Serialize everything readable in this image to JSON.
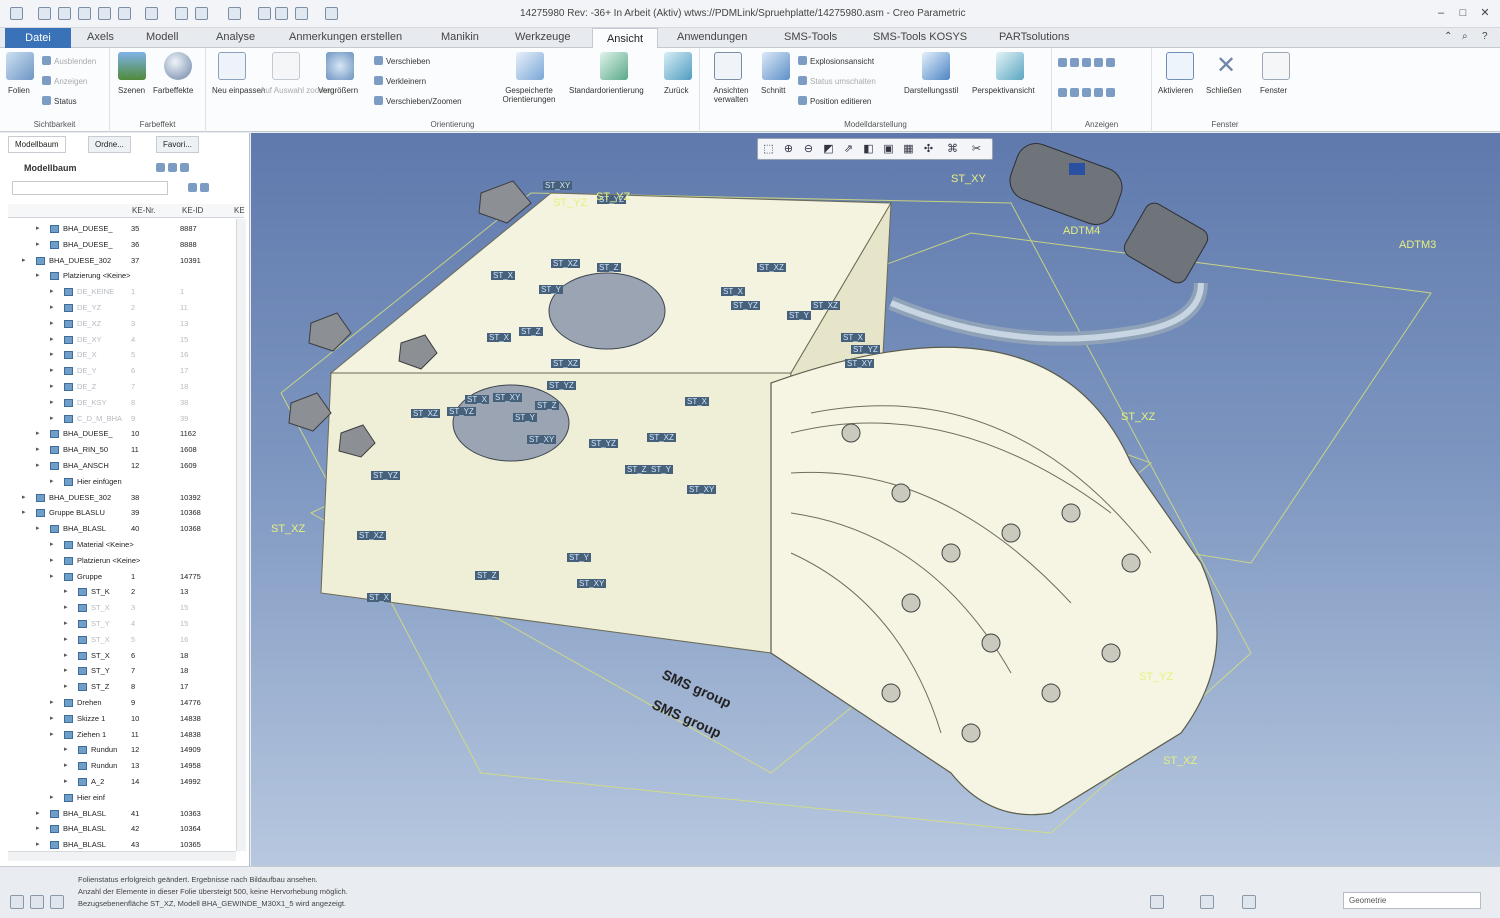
{
  "app": {
    "title": "14275980 Rev: -36+ In Arbeit (Aktiv) wtws://PDMLink/Spruehplatte/14275980.asm - Creo Parametric",
    "window_controls": [
      "minimize-icon",
      "restore-icon",
      "close-icon"
    ]
  },
  "menu": {
    "file": "Datei",
    "tabs": [
      "Axels",
      "Modell",
      "Analyse",
      "Anmerkungen erstellen",
      "Manikin",
      "Werkzeuge",
      "Ansicht",
      "Anwendungen",
      "SMS-Tools",
      "SMS-Tools KOSYS",
      "PARTsolutions"
    ],
    "active": "Ansicht"
  },
  "ribbon": {
    "sichtbarkeit": {
      "label": "Sichtbarkeit",
      "folien": "Folien",
      "ausblenden": "Ausblenden",
      "anzeigen": "Anzeigen",
      "status": "Status"
    },
    "farbeffekt": {
      "label": "Farbeffekt",
      "szenen": "Szenen",
      "farbeffekte": "Farbeffekte"
    },
    "orientierung": {
      "label": "Orientierung",
      "neu_einpassen": "Neu einpassen",
      "auf_auswahl_zoomen": "Auf Auswahl zoomen",
      "vergroessern": "Vergrößern",
      "verschieben": "Verschieben",
      "verkleinern": "Verkleinern",
      "verschieben_zoomen": "Verschieben/Zoomen",
      "gespeicherte": "Gespeicherte Orientierungen",
      "standard": "Standardorientierung",
      "zurueck": "Zurück"
    },
    "modelldarstellung": {
      "label": "Modelldarstellung",
      "ansichten_verwalten": "Ansichten verwalten",
      "schnitt": "Schnitt",
      "explosion": "Explosionsansicht",
      "status_umschalten": "Status umschalten",
      "position_editieren": "Position editieren",
      "darstellungsstil": "Darstellungsstil",
      "perspektive": "Perspektivansicht"
    },
    "anzeigen": {
      "label": "Anzeigen"
    },
    "fenster": {
      "label": "Fenster",
      "aktivieren": "Aktivieren",
      "schliessen": "Schließen",
      "fenster": "Fenster"
    }
  },
  "sidebar": {
    "tabs": [
      "Modellbaum",
      "Ordne...",
      "Favori..."
    ],
    "title": "Modellbaum",
    "columns": [
      "KE-Nr.",
      "KE-ID",
      "KE"
    ],
    "rows": [
      {
        "name": "BHA_DUESE_",
        "ke": "35",
        "id": "8887",
        "indent": 1,
        "dim": false
      },
      {
        "name": "BHA_DUESE_",
        "ke": "36",
        "id": "8888",
        "indent": 1,
        "dim": false
      },
      {
        "name": "BHA_DUESE_302",
        "ke": "37",
        "id": "10391",
        "indent": 0,
        "dim": false
      },
      {
        "name": "Platzierung <Keine>",
        "ke": "",
        "id": "",
        "indent": 1,
        "dim": false
      },
      {
        "name": "DE_KEINE",
        "ke": "1",
        "id": "1",
        "indent": 2,
        "dim": true
      },
      {
        "name": "DE_YZ",
        "ke": "2",
        "id": "11",
        "indent": 2,
        "dim": true
      },
      {
        "name": "DE_XZ",
        "ke": "3",
        "id": "13",
        "indent": 2,
        "dim": true
      },
      {
        "name": "DE_XY",
        "ke": "4",
        "id": "15",
        "indent": 2,
        "dim": true
      },
      {
        "name": "DE_X",
        "ke": "5",
        "id": "16",
        "indent": 2,
        "dim": true
      },
      {
        "name": "DE_Y",
        "ke": "6",
        "id": "17",
        "indent": 2,
        "dim": true
      },
      {
        "name": "DE_Z",
        "ke": "7",
        "id": "18",
        "indent": 2,
        "dim": true
      },
      {
        "name": "DE_KSY",
        "ke": "8",
        "id": "38",
        "indent": 2,
        "dim": true
      },
      {
        "name": "C_D_M_BHA",
        "ke": "9",
        "id": "39",
        "indent": 2,
        "dim": true
      },
      {
        "name": "BHA_DUESE_",
        "ke": "10",
        "id": "1162",
        "indent": 1,
        "dim": false
      },
      {
        "name": "BHA_RIN_50",
        "ke": "11",
        "id": "1608",
        "indent": 1,
        "dim": false
      },
      {
        "name": "BHA_ANSCH",
        "ke": "12",
        "id": "1609",
        "indent": 1,
        "dim": false
      },
      {
        "name": "Hier einfügen",
        "ke": "",
        "id": "",
        "indent": 2,
        "dim": false
      },
      {
        "name": "BHA_DUESE_302",
        "ke": "38",
        "id": "10392",
        "indent": 0,
        "dim": false
      },
      {
        "name": "Gruppe BLASLU",
        "ke": "39",
        "id": "10368",
        "indent": 0,
        "dim": false
      },
      {
        "name": "BHA_BLASL",
        "ke": "40",
        "id": "10368",
        "indent": 1,
        "dim": false
      },
      {
        "name": "Material <Keine>",
        "ke": "",
        "id": "",
        "indent": 2,
        "dim": false
      },
      {
        "name": "Platzierun <Keine>",
        "ke": "",
        "id": "",
        "indent": 2,
        "dim": false
      },
      {
        "name": "Gruppe",
        "ke": "1",
        "id": "14775",
        "indent": 2,
        "dim": false
      },
      {
        "name": "ST_K",
        "ke": "2",
        "id": "13",
        "indent": 3,
        "dim": false
      },
      {
        "name": "ST_X",
        "ke": "3",
        "id": "15",
        "indent": 3,
        "dim": true
      },
      {
        "name": "ST_Y",
        "ke": "4",
        "id": "15",
        "indent": 3,
        "dim": true
      },
      {
        "name": "ST_X",
        "ke": "5",
        "id": "16",
        "indent": 3,
        "dim": true
      },
      {
        "name": "ST_X",
        "ke": "6",
        "id": "18",
        "indent": 3,
        "dim": false
      },
      {
        "name": "ST_Y",
        "ke": "7",
        "id": "18",
        "indent": 3,
        "dim": false
      },
      {
        "name": "ST_Z",
        "ke": "8",
        "id": "17",
        "indent": 3,
        "dim": false
      },
      {
        "name": "Drehen",
        "ke": "9",
        "id": "14776",
        "indent": 2,
        "dim": false
      },
      {
        "name": "Skizze 1",
        "ke": "10",
        "id": "14838",
        "indent": 2,
        "dim": false
      },
      {
        "name": "Ziehen 1",
        "ke": "11",
        "id": "14838",
        "indent": 2,
        "dim": false
      },
      {
        "name": "Rundun",
        "ke": "12",
        "id": "14909",
        "indent": 3,
        "dim": false
      },
      {
        "name": "Rundun",
        "ke": "13",
        "id": "14958",
        "indent": 3,
        "dim": false
      },
      {
        "name": "A_2",
        "ke": "14",
        "id": "14992",
        "indent": 3,
        "dim": false
      },
      {
        "name": "Hier einf",
        "ke": "",
        "id": "",
        "indent": 2,
        "dim": false
      },
      {
        "name": "BHA_BLASL",
        "ke": "41",
        "id": "10363",
        "indent": 1,
        "dim": false
      },
      {
        "name": "BHA_BLASL",
        "ke": "42",
        "id": "10364",
        "indent": 1,
        "dim": false
      },
      {
        "name": "BHA_BLASL",
        "ke": "43",
        "id": "10365",
        "indent": 1,
        "dim": false
      }
    ]
  },
  "viewport": {
    "datum_labels": [
      "ST_XY",
      "ST_YZ",
      "ST_XZ",
      "ST_X",
      "ST_Y",
      "ST_Z",
      "ST_X",
      "ST_XZ",
      "ST_YZ",
      "ST_Y",
      "ST_XZ",
      "ST_X",
      "ST_YZ",
      "ST_XY",
      "ST_Z",
      "ST_X",
      "ST_XZ",
      "ST_YZ",
      "ST_XY",
      "ST_Z",
      "ST_YZ",
      "ST_XZ",
      "ST_X",
      "ST_Y",
      "ST_XY",
      "ST_YZ",
      "ST_XZ",
      "ST_X",
      "ST_Y",
      "ST_Z",
      "ST_XY",
      "ST_YZ",
      "ST_XZ",
      "ST_X",
      "ST_Z",
      "ST_Y",
      "ST_XY"
    ],
    "plane_labels": [
      "ST_XY",
      "ST_XZ",
      "ST_XZ",
      "ST_YZ",
      "ST_YZ",
      "ST_XZ",
      "ADTM4",
      "ADTM3",
      "ST_YZ"
    ],
    "brand": "SMS group",
    "toolbar_icons": [
      "refit-icon",
      "zoom-in-icon",
      "zoom-out-icon",
      "repaint-icon",
      "saved-views-icon",
      "display-style-icon",
      "view-manager-icon",
      "datum-display-icon",
      "spin-center-icon",
      "annotation-display-icon",
      "sketch-icon"
    ]
  },
  "status": {
    "messages": [
      "Folienstatus erfolgreich geändert. Ergebnisse nach Bildaufbau ansehen.",
      "Anzahl der Elemente in dieser Folie übersteigt 500, keine Hervorhebung möglich.",
      "Bezugsebenenfläche ST_XZ, Modell BHA_GEWINDE_M30X1_5 wird angezeigt."
    ],
    "filter_value": "Geometrie"
  },
  "colors": {
    "accent": "#3a72b8",
    "viewport_top": "#5f79ad",
    "viewport_bottom": "#b7c8df",
    "datum_label_bg": "#48617a",
    "plane_label": "#e7f07e"
  }
}
